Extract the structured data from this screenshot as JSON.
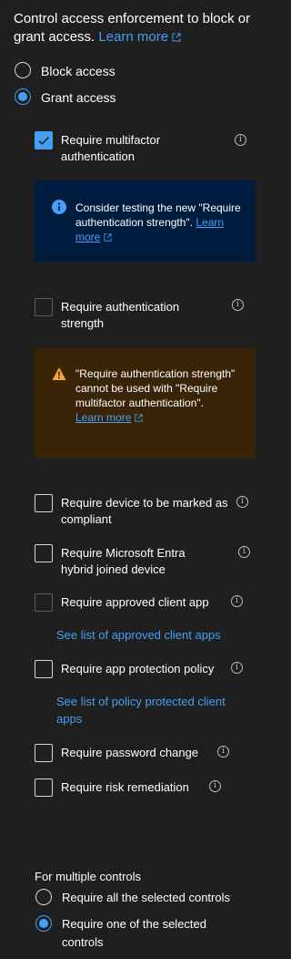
{
  "intro": {
    "text": "Control access enforcement to block or grant access.",
    "learn_more": "Learn more"
  },
  "access_mode": {
    "selected": "Grant access",
    "options": [
      "Block access",
      "Grant access"
    ]
  },
  "controls": [
    {
      "label": "Require multifactor authentication",
      "checked": true,
      "disabled": false
    },
    {
      "label": "Require authentication strength",
      "checked": false,
      "disabled": true
    },
    {
      "label": "Require device to be marked as compliant",
      "checked": false,
      "disabled": false
    },
    {
      "label": "Require Microsoft Entra hybrid joined device",
      "checked": false,
      "disabled": false
    },
    {
      "label": "Require approved client app",
      "checked": false,
      "disabled": true,
      "link": "See list of approved client apps"
    },
    {
      "label": "Require app protection policy",
      "checked": false,
      "disabled": false,
      "link": "See list of policy protected client apps"
    },
    {
      "label": "Require password change",
      "checked": false,
      "disabled": false
    },
    {
      "label": "Require risk remediation",
      "checked": false,
      "disabled": false
    }
  ],
  "info_message": {
    "text": "Consider testing the new \"Require authentication strength\".",
    "learn_more": "Learn more"
  },
  "warning_message": {
    "text": "\"Require authentication strength\" cannot be used with \"Require multifactor authentication\".",
    "learn_more": "Learn more"
  },
  "multiple_controls": {
    "title": "For multiple controls",
    "selected": "Require one of the selected controls",
    "options": [
      "Require all the selected controls",
      "Require one of the selected controls"
    ]
  },
  "colors": {
    "background": "#1f1f1f",
    "accent": "#479ef5",
    "info_bar": "#001d3f",
    "warning_bar": "#3a2408",
    "warning_icon": "#f7a53c"
  }
}
